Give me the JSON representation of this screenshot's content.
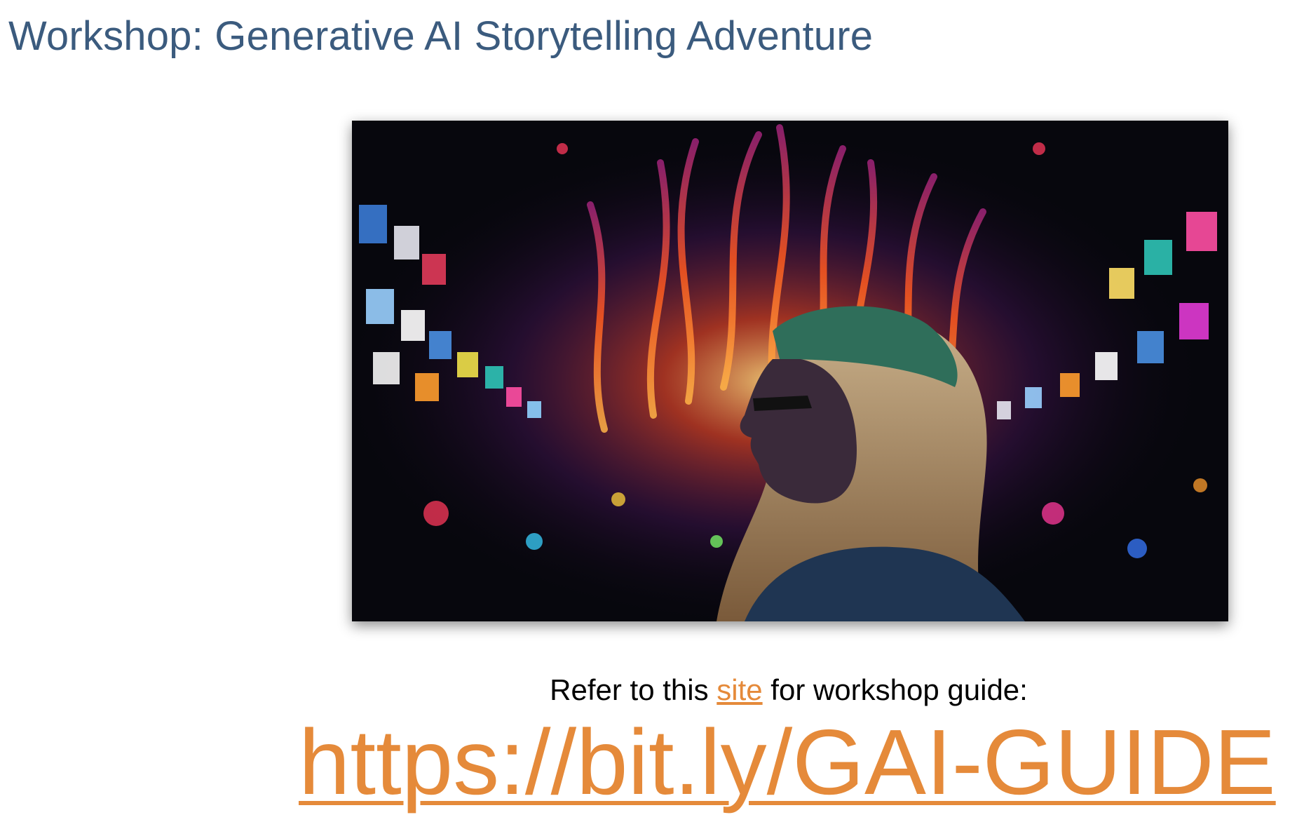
{
  "slide": {
    "title": "Workshop: Generative AI Storytelling Adventure"
  },
  "hero_image": {
    "alt": "Colorful digital art of a woman in profile wearing glasses and a headband, surrounded by floating screens and flame-like streaks of light"
  },
  "refer": {
    "prefix": "Refer to this ",
    "link_text": "site",
    "suffix": " for workshop guide:"
  },
  "guide": {
    "url_text": "https://bit.ly/GAI-GUIDE"
  },
  "colors": {
    "title": "#3b5b7e",
    "link": "#e58a3a",
    "body_text": "#000000"
  }
}
